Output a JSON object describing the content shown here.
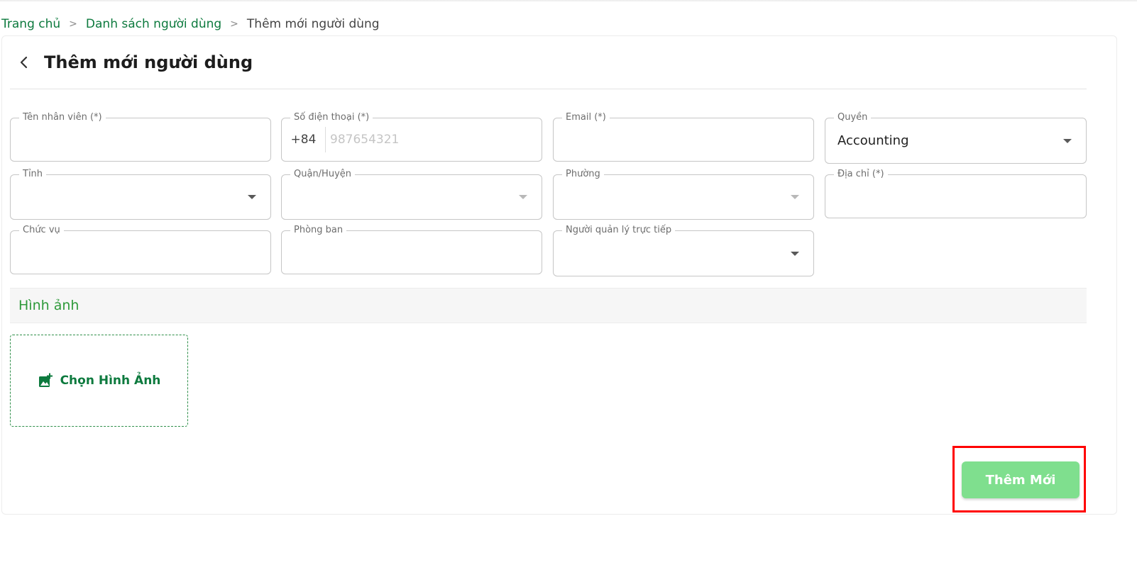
{
  "breadcrumb": {
    "home": "Trang chủ",
    "users": "Danh sách người dùng",
    "current": "Thêm mới người dùng",
    "separator": ">"
  },
  "page": {
    "title": "Thêm mới người dùng",
    "back_icon": "chevron-left-icon"
  },
  "form": {
    "employee_name": {
      "label": "Tên nhân viên (*)",
      "value": ""
    },
    "phone": {
      "label": "Số điện thoại (*)",
      "prefix": "+84",
      "placeholder": "987654321",
      "value": ""
    },
    "email": {
      "label": "Email (*)",
      "value": ""
    },
    "role": {
      "label": "Quyền",
      "value": "Accounting"
    },
    "province": {
      "label": "Tỉnh",
      "value": ""
    },
    "district": {
      "label": "Quận/Huyện",
      "value": ""
    },
    "ward": {
      "label": "Phường",
      "value": ""
    },
    "address": {
      "label": "Địa chỉ (*)",
      "value": ""
    },
    "position": {
      "label": "Chức vụ",
      "value": ""
    },
    "department": {
      "label": "Phòng ban",
      "value": ""
    },
    "manager": {
      "label": "Người quản lý trực tiếp",
      "value": ""
    }
  },
  "images": {
    "section_title": "Hình ảnh",
    "upload_label": "Chọn Hình Ảnh",
    "upload_icon": "add-photo-icon"
  },
  "actions": {
    "submit_label": "Thêm Mới"
  },
  "colors": {
    "primary_green": "#0d7a3e",
    "section_green": "#2f9a3b",
    "button_green": "#7fdf8e",
    "highlight_red": "#ff0000"
  }
}
